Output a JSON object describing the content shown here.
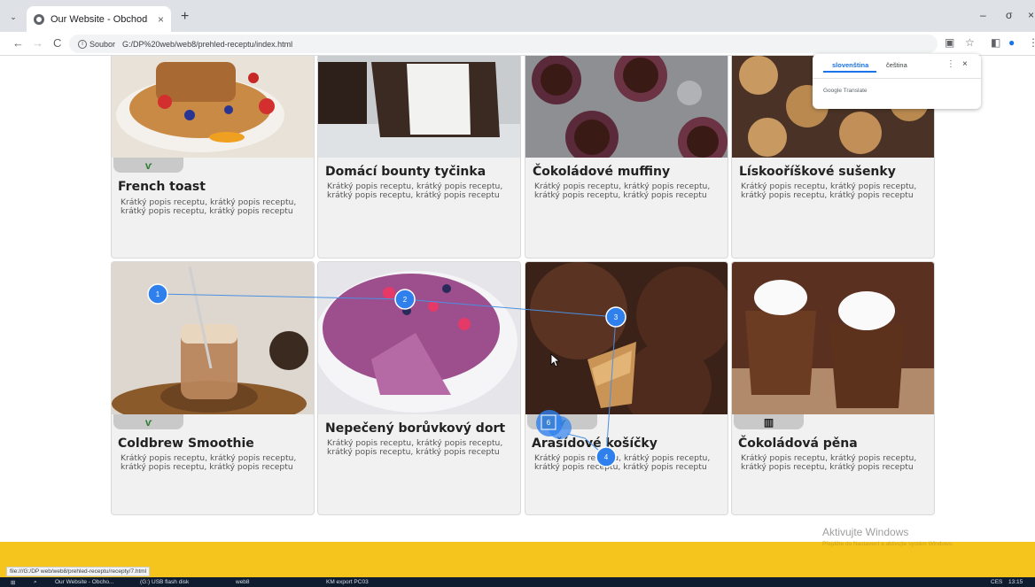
{
  "browser": {
    "tab_title": "Our Website - Obchod",
    "tab_close": "×",
    "new_tab": "+",
    "tab_menu": "⌄",
    "window_controls": [
      "–",
      "σ",
      "×"
    ],
    "nav": {
      "back": "←",
      "forward": "→",
      "reload": "C"
    },
    "omnibox": {
      "info": "i",
      "chip": "Soubor",
      "url": "G:/DP%20web/web8/prehled-receptu/index.html"
    },
    "toolbar_icons": [
      "translate-icon",
      "star-icon",
      "sidebar-icon",
      "profile-icon",
      "menu-icon"
    ]
  },
  "translate_popup": {
    "lang_active": "slovenština",
    "lang_other": "čeština",
    "more": "⋮",
    "close": "×",
    "brand": "Google Translate"
  },
  "recipes": [
    {
      "title": "French toast",
      "desc": "Krátký popis receptu, krátký popis receptu, krátký popis receptu, krátký popis receptu",
      "tag": "vegan",
      "tag_icon": "leaf-icon"
    },
    {
      "title": "Domácí bounty tyčinka",
      "desc": "Krátký popis receptu, krátký popis receptu, krátký popis receptu, krátký popis receptu",
      "tag": ""
    },
    {
      "title": "Čokoládové muffiny",
      "desc": "Krátký popis receptu, krátký popis receptu, krátký popis receptu, krátký popis receptu",
      "tag": ""
    },
    {
      "title": "Lískooříškové sušenky",
      "desc": "Krátký popis receptu, krátký popis receptu, krátký popis receptu, krátký popis receptu",
      "tag": ""
    },
    {
      "title": "Coldbrew Smoothie",
      "desc": "Krátký popis receptu, krátký popis receptu, krátký popis receptu, krátký popis receptu",
      "tag": "vegan",
      "tag_icon": "leaf-icon"
    },
    {
      "title": "Nepečený borůvkový dort",
      "desc": "Krátký popis receptu, krátký popis receptu, krátký popis receptu, krátký popis receptu",
      "tag": ""
    },
    {
      "title": "Arašídové košíčky",
      "desc": "Krátký popis receptu, krátký popis receptu, krátký popis receptu, krátký popis receptu",
      "tag": "vegan",
      "tag_icon": "leaf-icon"
    },
    {
      "title": "Čokoládová pěna",
      "desc": "Krátký popis receptu, krátký popis receptu, krátký popis receptu, krátký popis receptu",
      "tag": "other",
      "tag_icon": "book-icon"
    }
  ],
  "markers": [
    "1",
    "2",
    "3",
    "4",
    "6"
  ],
  "windows_watermark": {
    "title": "Aktivujte Windows",
    "subtitle": "Přejděte do Nastavení a aktivujte systém Windows."
  },
  "status_url": "file:///G:/DP web/web8/prehled-receptu/recepty/7.html",
  "taskbar": {
    "items": [
      "Our Website - Obcho...",
      "(G:) USB flash disk",
      "web8",
      "KM export PC03"
    ],
    "tray": "CES",
    "time": "13:15"
  }
}
